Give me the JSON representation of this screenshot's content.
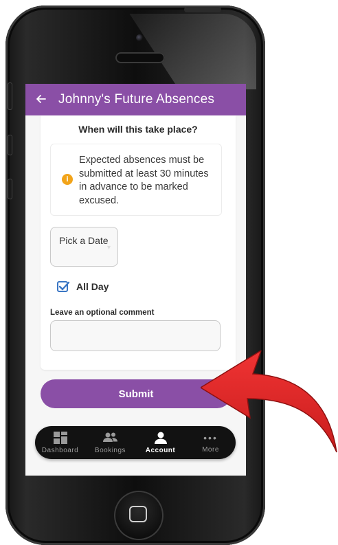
{
  "header": {
    "back_icon": "back-arrow-icon",
    "title": "Johnny's Future Absences"
  },
  "form": {
    "question": "When will this take place?",
    "notice": "Expected absences must be submitted at least 30 minutes in advance to be marked excused.",
    "notice_icon": "info-icon",
    "date_button_label": "Pick a Date",
    "all_day_label": "All Day",
    "all_day_checked": true,
    "comment_label": "Leave an optional comment",
    "comment_value": "",
    "submit_label": "Submit"
  },
  "bottom_nav": {
    "items": [
      {
        "label": "Dashboard",
        "icon": "dashboard-icon"
      },
      {
        "label": "Bookings",
        "icon": "people-icon"
      },
      {
        "label": "Account",
        "icon": "person-icon",
        "active": true
      },
      {
        "label": "More",
        "icon": "more-dots-icon"
      }
    ]
  },
  "colors": {
    "accent": "#8a4fa6",
    "warning": "#f2a41a",
    "checkbox": "#3a76c4",
    "arrow": "#e02a2a",
    "nav_background": "#121212"
  }
}
